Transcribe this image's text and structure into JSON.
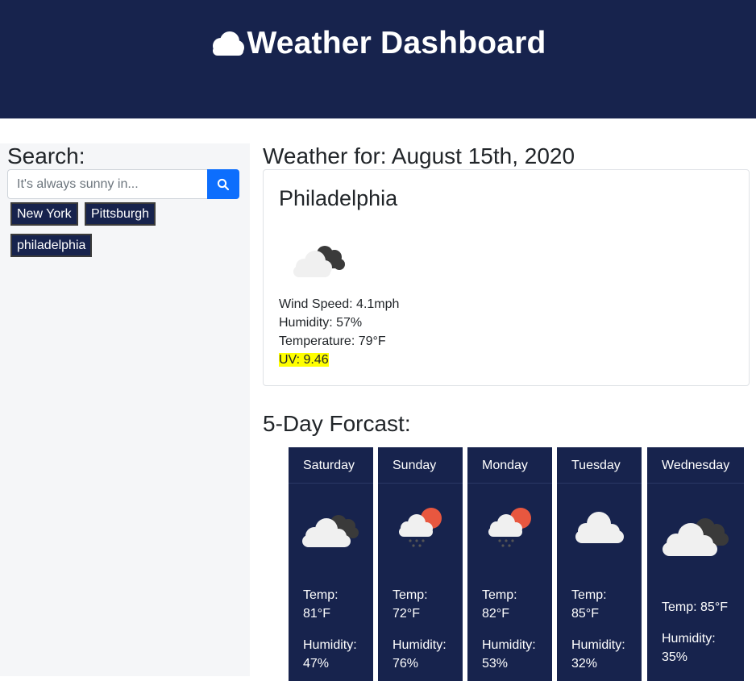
{
  "header": {
    "title": "Weather Dashboard",
    "icon": "cloud-icon"
  },
  "sidebar": {
    "heading": "Search:",
    "search_placeholder": "It's always sunny in...",
    "history": [
      "New York",
      "Pittsburgh",
      "philadelphia"
    ]
  },
  "current": {
    "heading": "Weather for: August 15th, 2020",
    "city": "Philadelphia",
    "icon": "cloudy-icon",
    "wind": "Wind Speed: 4.1mph",
    "humidity": "Humidity: 57%",
    "temperature": "Temperature: 79°F",
    "uv": "UV: 9.46",
    "uv_color": "#ffff00"
  },
  "forecast": {
    "heading": "5-Day Forcast:",
    "days": [
      {
        "day": "Saturday",
        "temp": "Temp: 81°F",
        "humidity": "Humidity: 47%",
        "icon": "cloudy-icon"
      },
      {
        "day": "Sunday",
        "temp": "Temp: 72°F",
        "humidity": "Humidity: 76%",
        "icon": "rain-sun-icon"
      },
      {
        "day": "Monday",
        "temp": "Temp: 82°F",
        "humidity": "Humidity: 53%",
        "icon": "rain-sun-icon"
      },
      {
        "day": "Tuesday",
        "temp": "Temp: 85°F",
        "humidity": "Humidity: 32%",
        "icon": "cloud-icon"
      },
      {
        "day": "Wednesday",
        "temp": "Temp: 85°F",
        "humidity": "Humidity: 35%",
        "icon": "cloudy-icon"
      }
    ]
  },
  "colors": {
    "navy": "#17234d",
    "accent": "#0d6efd"
  }
}
